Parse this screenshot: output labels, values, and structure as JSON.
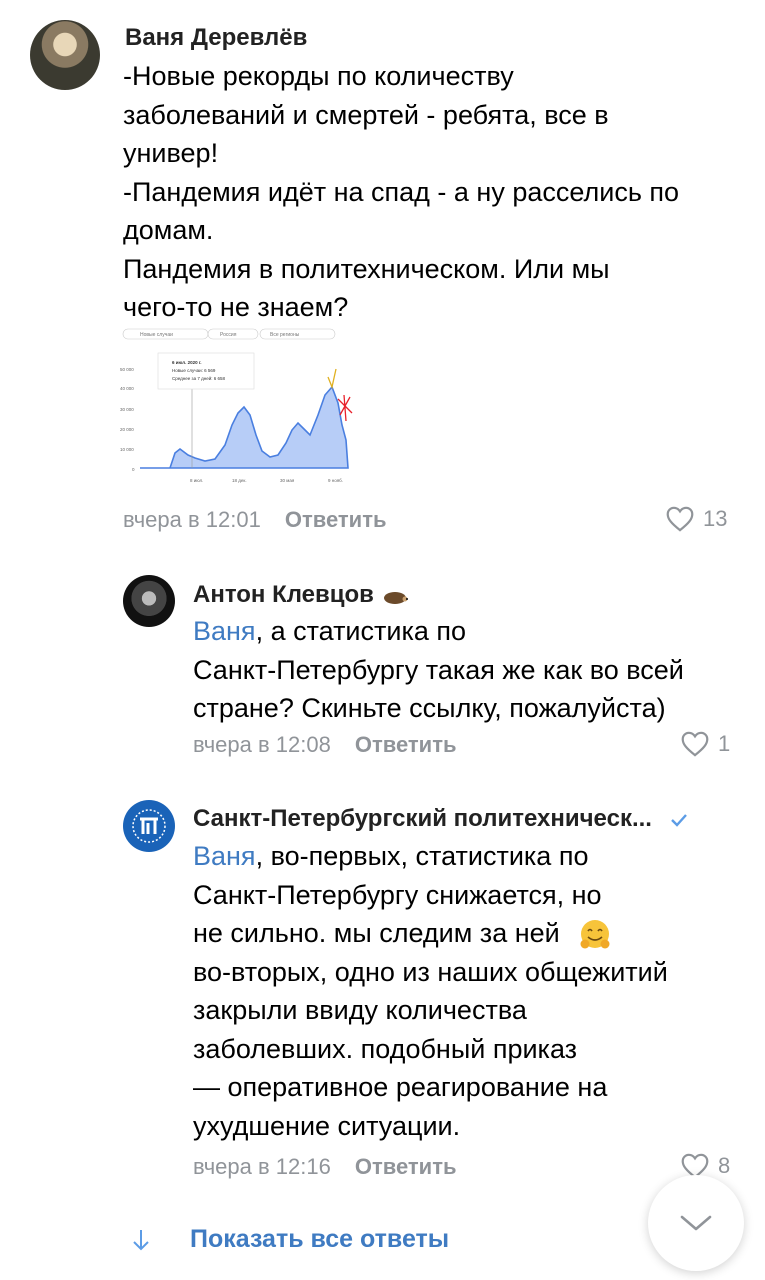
{
  "comments": [
    {
      "author": "Ваня Деревлёв",
      "lines": [
        "-Новые рекорды по количеству",
        "заболеваний и смертей - ребята, все в",
        "универ!",
        "-Пандемия идёт на спад - а ну расселись по",
        "домам.",
        "Пандемия в политехническом. Или мы",
        "чего-то не знаем?"
      ],
      "time": "вчера в 12:01",
      "reply_label": "Ответить",
      "likes": "13"
    },
    {
      "author": "Антон Клевцов",
      "mention": "Ваня",
      "lines": [
        ", а статистика по",
        "Санкт-Петербургу такая же как во всей",
        "стране? Скиньте ссылку, пожалуйста)"
      ],
      "time": "вчера в 12:08",
      "reply_label": "Ответить",
      "likes": "1"
    },
    {
      "author": "Санкт-Петербургский политехническ...",
      "mention": "Ваня",
      "lines": [
        ", во-первых, статистика по",
        "Санкт-Петербургу снижается, но",
        "не сильно. мы следим за ней",
        "во-вторых, одно из наших общежитий",
        "закрыли ввиду количества",
        "заболевших. подобный приказ",
        "— оперативное реагирование на",
        "ухудшение ситуации."
      ],
      "time": "вчера в 12:16",
      "reply_label": "Ответить",
      "likes": "8"
    }
  ],
  "embedded_chart": {
    "filters": [
      "Новые случаи",
      "Россия",
      "Все регионы"
    ],
    "tooltip": {
      "date": "6 июл. 2020 г.",
      "new_cases": "Новые случаи: 6 569",
      "avg": "Среднее за 7 дней: 6 658"
    },
    "y_ticks": [
      "50 000",
      "40 000",
      "30 000",
      "20 000",
      "10 000",
      "0"
    ],
    "x_ticks": [
      "8 июл.",
      "18 дек.",
      "30 мая",
      "9 нояб."
    ]
  },
  "show_all_replies": "Показать все ответы",
  "colors": {
    "link": "#3f7bc2",
    "meta": "#909499"
  }
}
